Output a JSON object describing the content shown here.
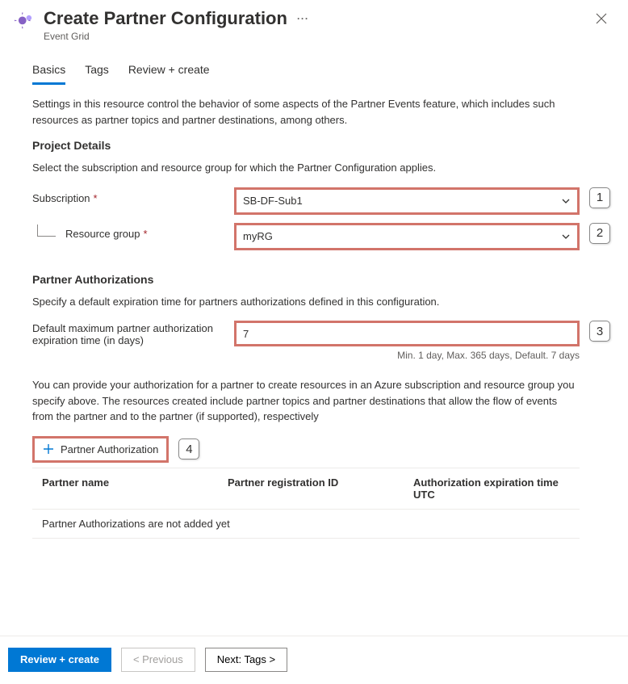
{
  "header": {
    "title": "Create Partner Configuration",
    "service": "Event Grid"
  },
  "tabs": {
    "basics": "Basics",
    "tags": "Tags",
    "review": "Review + create"
  },
  "intro": "Settings in this resource control the behavior of some aspects of the Partner Events feature, which includes such resources as partner topics and partner destinations, among others.",
  "project": {
    "heading": "Project Details",
    "desc": "Select the subscription and resource group for which the Partner Configuration applies.",
    "subscription_label": "Subscription",
    "subscription_value": "SB-DF-Sub1",
    "rg_label": "Resource group",
    "rg_value": "myRG"
  },
  "auth": {
    "heading": "Partner Authorizations",
    "desc": "Specify a default expiration time for partners authorizations defined in this configuration.",
    "exp_label": "Default maximum partner authorization expiration time (in days)",
    "exp_value": "7",
    "exp_hint": "Min. 1 day, Max. 365 days, Default. 7 days",
    "info": "You can provide your authorization for a partner to create resources in an Azure subscription and resource group you specify above. The resources created include partner topics and partner destinations that allow the flow of events from the partner and to the partner (if supported), respectively",
    "add_label": "Partner Authorization",
    "col_name": "Partner name",
    "col_regid": "Partner registration ID",
    "col_exp": "Authorization expiration time UTC",
    "empty": "Partner Authorizations are not added yet"
  },
  "callouts": {
    "c1": "1",
    "c2": "2",
    "c3": "3",
    "c4": "4"
  },
  "footer": {
    "review": "Review + create",
    "prev": "< Previous",
    "next": "Next: Tags >"
  }
}
